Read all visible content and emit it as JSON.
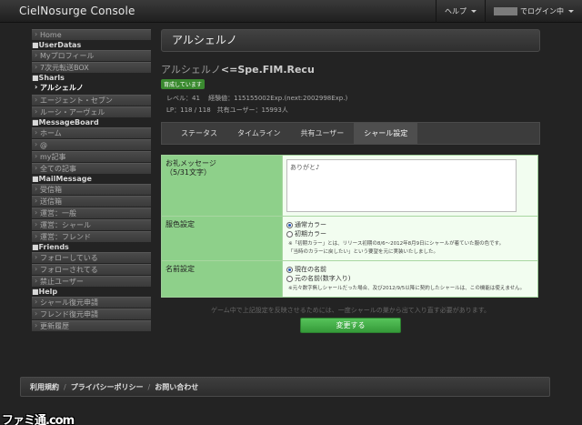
{
  "app": {
    "brand": "CielNosurge Console"
  },
  "nav": {
    "help": "ヘルプ",
    "login": "でログイン中"
  },
  "sidebar": {
    "home": "Home",
    "groups": [
      {
        "head": "■UserDatas",
        "items": [
          "Myプロフィール",
          "7次元転送BOX"
        ]
      },
      {
        "head": "■Sharls",
        "items": [
          "アルシェルノ",
          "エージェント・セブン",
          "ルーシ・アーヴェル"
        ]
      },
      {
        "head": "■MessageBoard",
        "items": [
          "ホーム",
          "@",
          "my記事",
          "全ての記事"
        ]
      },
      {
        "head": "■MailMessage",
        "items": [
          "受信箱",
          "送信箱",
          "運営：一般",
          "運営：シャール",
          "運営：フレンド"
        ]
      },
      {
        "head": "■Friends",
        "items": [
          "フォローしている",
          "フォローされてる",
          "禁止ユーザー"
        ]
      },
      {
        "head": "■Help",
        "items": [
          "シャール復元申請",
          "フレンド復元申請",
          "更新履歴"
        ]
      }
    ]
  },
  "main": {
    "title": "アルシェルノ",
    "char_name": "アルシェルノ",
    "char_sub": "<=Spe.FIM.Recu",
    "badge": "育成しています",
    "stats_line1": "レベル：41　 経験値：115155002Exp.(next:2002998Exp.)",
    "stats_line2": "LP：118 / 118　共有ユーザー：15993人",
    "tabs": [
      "ステータス",
      "タイムライン",
      "共有ユーザー",
      "シャール設定"
    ],
    "form": {
      "msg_label": "お礼メッセージ",
      "msg_sub": "（5/31文字）",
      "msg_value": "ありがと♪",
      "color_label": "服色設定",
      "color_opt1": "通常カラー",
      "color_opt2": "初期カラー",
      "color_note1": "※「初期カラー」とは、リリース初期の8/6〜2012年8月9日にシャールが着ていた服の色です。",
      "color_note2": "「当時のカラーに戻したい」という要望を元に実装いたしました。",
      "name_label": "名前設定",
      "name_opt1": "現在の名前",
      "name_opt2": "元の名前(数字入り)",
      "name_note": "※元々数字無しシャールだった場合、及び2012/9/5以降に契約したシャールは、この機能は使えません。"
    },
    "footer_note": "ゲーム中で上記設定を反映させるためには、一度シャールの巣から出て入り直す必要があります。",
    "submit": "変更する"
  },
  "footer": {
    "terms": "利用規約",
    "privacy": "プライバシーポリシー",
    "contact": "お問い合わせ",
    "sep": "/"
  },
  "watermark": "ファミ通.com"
}
